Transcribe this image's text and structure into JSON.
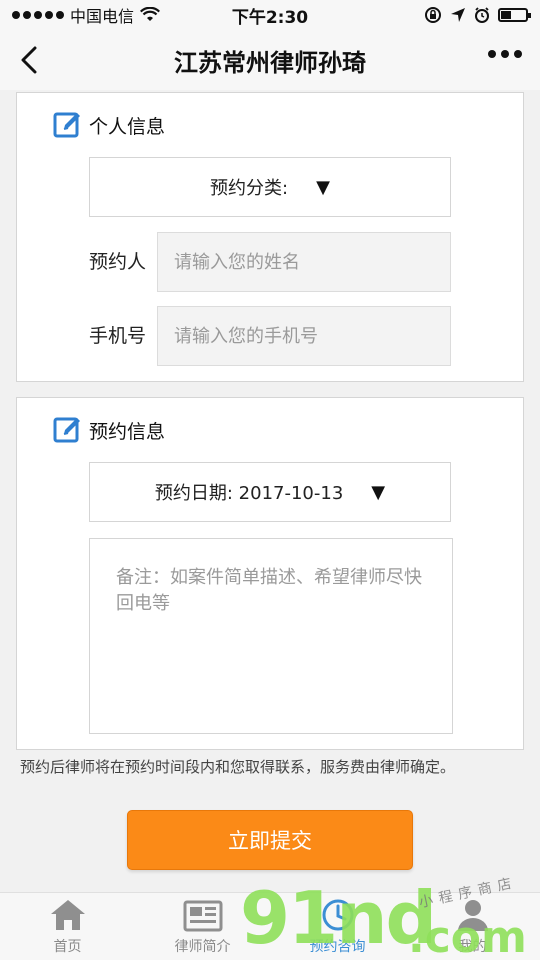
{
  "status_bar": {
    "carrier": "中国电信",
    "time": "下午2:30"
  },
  "nav": {
    "title": "江苏常州律师孙琦"
  },
  "personal_section": {
    "title": "个人信息",
    "category_select": "预约分类:",
    "name_label": "预约人",
    "name_placeholder": "请输入您的姓名",
    "phone_label": "手机号",
    "phone_placeholder": "请输入您的手机号"
  },
  "appointment_section": {
    "title": "预约信息",
    "date_select": "预约日期: 2017-10-13",
    "remark_placeholder": "备注：如案件简单描述、希望律师尽快回电等"
  },
  "hint": "预约后律师将在预约时间段内和您取得联系，服务费由律师确定。",
  "submit_label": "立即提交",
  "tabs": [
    {
      "label": "首页",
      "icon": "home-icon"
    },
    {
      "label": "律师简介",
      "icon": "newspaper-icon"
    },
    {
      "label": "预约咨询",
      "icon": "clock-icon"
    },
    {
      "label": "我的",
      "icon": "user-icon"
    }
  ],
  "watermark": {
    "brand": "91nd",
    "suffix": ".com",
    "tagline": "小程序商店"
  },
  "colors": {
    "accent": "#fb8a17",
    "icon_blue": "#2f7fd0",
    "active_tab": "#3b8ed4"
  }
}
